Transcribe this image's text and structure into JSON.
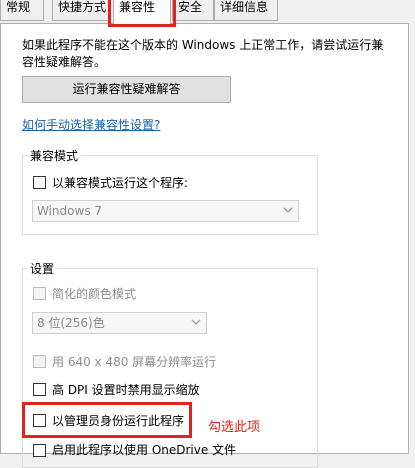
{
  "tabs": [
    "常规",
    "快捷方式",
    "兼容性",
    "安全",
    "详细信息"
  ],
  "intro_text_line1": "如果此程序不能在这个版本的 Windows 上正常工作，请尝试运行兼",
  "intro_text_line2": "容性疑难解答。",
  "troubleshoot_button": "运行兼容性疑难解答",
  "manual_link": "如何手动选择兼容性设置?",
  "compat_group": {
    "label": "兼容模式",
    "checkbox_label": "以兼容模式运行这个程序:",
    "select_value": "Windows 7"
  },
  "settings_group": {
    "label": "设置",
    "reduced_color": "简化的颜色模式",
    "color_select": "8 位(256)色",
    "res_640": "用 640 x 480 屏幕分辨率运行",
    "high_dpi": "高 DPI 设置时禁用显示缩放",
    "run_as_admin": "以管理员身份运行此程序",
    "onedrive": "启用此程序以使用 OneDrive 文件"
  },
  "annotation": "勾选此项",
  "colors": {
    "highlight": "#e0231c",
    "link": "#1a5ea8"
  }
}
